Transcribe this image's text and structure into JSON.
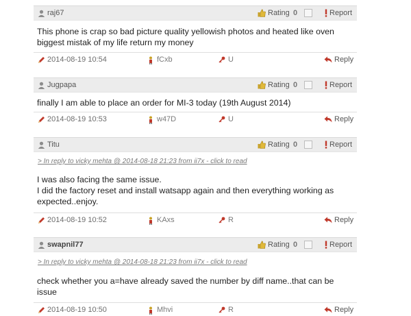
{
  "comments": [
    {
      "username": "raj67",
      "username_bold": false,
      "rating_label": "Rating",
      "rating_value": "0",
      "report_label": "Report",
      "in_reply": "",
      "body_lines": [
        "This phone is crap so bad picture quality yellowish photos and heated like oven",
        "biggest mistak of my life return my money"
      ],
      "date": "2014-08-19 10:54",
      "user_id": "fCxb",
      "flag": "U",
      "reply_label": "Reply"
    },
    {
      "username": "Jugpapa",
      "username_bold": false,
      "rating_label": "Rating",
      "rating_value": "0",
      "report_label": "Report",
      "in_reply": "",
      "body_lines": [
        "finally I am able to place an order for MI-3 today (19th August 2014)"
      ],
      "date": "2014-08-19 10:53",
      "user_id": "w47D",
      "flag": "U",
      "reply_label": "Reply"
    },
    {
      "username": "Titu",
      "username_bold": false,
      "rating_label": "Rating",
      "rating_value": "0",
      "report_label": "Report",
      "in_reply": "> In reply to vicky mehta @ 2014-08-18 21:23 from ii7x - click to read",
      "body_lines": [
        "I was also facing the same issue.",
        "I did the factory reset and install watsapp again and then everything working as",
        "expected..enjoy."
      ],
      "date": "2014-08-19 10:52",
      "user_id": "KAxs",
      "flag": "R",
      "reply_label": "Reply"
    },
    {
      "username": "swapnil77",
      "username_bold": true,
      "rating_label": "Rating",
      "rating_value": "0",
      "report_label": "Report",
      "in_reply": "> In reply to vicky mehta @ 2014-08-18 21:23 from ii7x - click to read",
      "body_lines": [
        "check whether you a=have already saved the number by diff name..that can be",
        "issue"
      ],
      "date": "2014-08-19 10:50",
      "user_id": "Mhvi",
      "flag": "R",
      "reply_label": "Reply"
    }
  ],
  "icons": {
    "user": "user-icon",
    "rating": "thumbs-up-icon",
    "report": "exclamation-icon",
    "date": "pen-icon",
    "id": "person-icon",
    "flag": "key-icon",
    "reply": "reply-arrow-icon"
  },
  "colors": {
    "header_bg": "#ececec",
    "icon_red": "#c0392b",
    "icon_gold": "#c9a227",
    "icon_green": "#3a8f3a",
    "link_gray": "#7a7a7a"
  }
}
